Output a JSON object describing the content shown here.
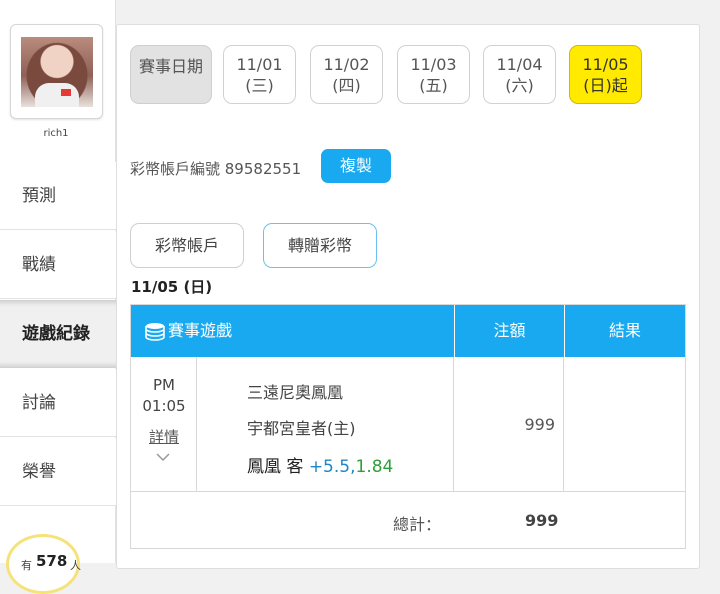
{
  "user": {
    "name": "rich1"
  },
  "sidebar": {
    "items": [
      {
        "label": "預測"
      },
      {
        "label": "戰績"
      },
      {
        "label": "遊戲紀錄"
      },
      {
        "label": "討論"
      },
      {
        "label": "榮譽"
      }
    ],
    "badge": {
      "prefix": "有",
      "count": "578",
      "suffix": "人"
    }
  },
  "dates": {
    "label": "賽事日期",
    "days": [
      {
        "date": "11/01",
        "weekday": "(三)"
      },
      {
        "date": "11/02",
        "weekday": "(四)"
      },
      {
        "date": "11/03",
        "weekday": "(五)"
      },
      {
        "date": "11/04",
        "weekday": "(六)"
      },
      {
        "date": "11/05",
        "weekday": "(日)起"
      }
    ]
  },
  "account": {
    "label": "彩幣帳戶編號 89582551",
    "copy": "複製"
  },
  "tabs": {
    "wallet": "彩幣帳戶",
    "transfer": "轉贈彩幣"
  },
  "section_date": "11/05 (日)",
  "table": {
    "headers": {
      "game": "賽事遊戲",
      "amount": "注額",
      "result": "結果"
    },
    "rows": [
      {
        "time_ampm": "PM",
        "time": "01:05",
        "detail": "詳情",
        "away": "三遠尼奧鳳凰",
        "home": "宇都宮皇者(主)",
        "pick": "鳳凰 客",
        "handicap": "+5.5",
        "odds_sep": ",",
        "odds": "1.84",
        "amount": "999",
        "result": ""
      }
    ],
    "total_label": "總計：",
    "total_value": "999"
  },
  "colors": {
    "accent": "#18a9f0",
    "highlight": "#ffea00",
    "handicap": "#1d87c6",
    "odds": "#2e9e3a"
  }
}
